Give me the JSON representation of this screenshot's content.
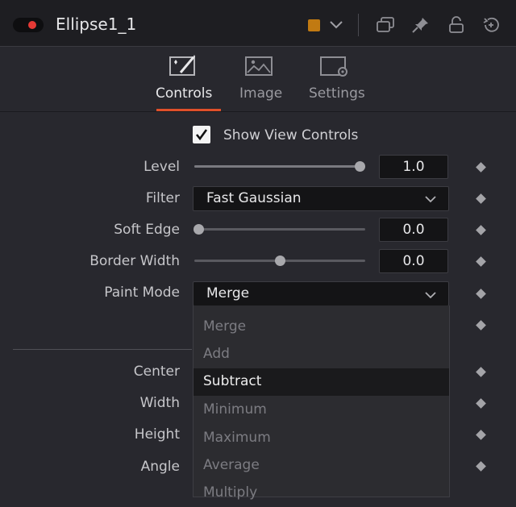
{
  "header": {
    "title": "Ellipse1_1",
    "color_swatch": "#c17a12",
    "toggle_color": "#e53935"
  },
  "tabs": [
    {
      "label": "Controls",
      "icon": "controls-icon",
      "active": true
    },
    {
      "label": "Image",
      "icon": "image-icon",
      "active": false
    },
    {
      "label": "Settings",
      "icon": "settings-icon",
      "active": false
    }
  ],
  "controls": {
    "show_view_controls": {
      "label": "Show View Controls",
      "checked": true
    },
    "level": {
      "label": "Level",
      "value": "1.0",
      "fraction": 1.0
    },
    "filter": {
      "label": "Filter",
      "value": "Fast Gaussian"
    },
    "soft_edge": {
      "label": "Soft Edge",
      "value": "0.0",
      "fraction": 0.0
    },
    "border_width": {
      "label": "Border Width",
      "value": "0.0",
      "fraction": 0.5
    },
    "paint_mode": {
      "label": "Paint Mode",
      "value": "Merge"
    }
  },
  "transform": {
    "center": "Center",
    "width": "Width",
    "height": "Height",
    "angle": "Angle"
  },
  "paint_mode_options": [
    "Merge",
    "Add",
    "Subtract",
    "Minimum",
    "Maximum",
    "Average",
    "Multiply"
  ],
  "paint_mode_highlighted": "Subtract"
}
